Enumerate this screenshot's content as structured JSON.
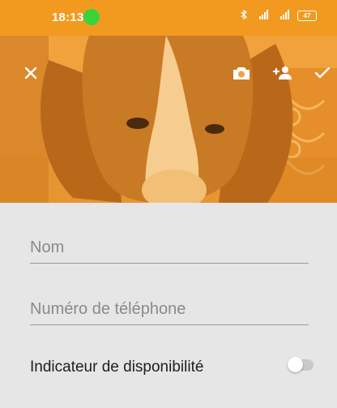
{
  "status_bar": {
    "time": "18:13",
    "network_1": "⁴ᴳ",
    "network_2": "ᴴ⁺",
    "battery": "47"
  },
  "header": {
    "close_icon": "close-icon",
    "camera_icon": "camera-icon",
    "add_contact_icon": "add-person-icon",
    "confirm_icon": "check-icon"
  },
  "form": {
    "name": {
      "value": "",
      "placeholder": "Nom"
    },
    "phone": {
      "value": "",
      "placeholder": "Numéro de téléphone"
    },
    "availability": {
      "label": "Indicateur de disponibilité",
      "enabled": false
    }
  },
  "colors": {
    "accent": "#f29a1f",
    "status_dot": "#39d43b",
    "background": "#e6e6e6"
  }
}
